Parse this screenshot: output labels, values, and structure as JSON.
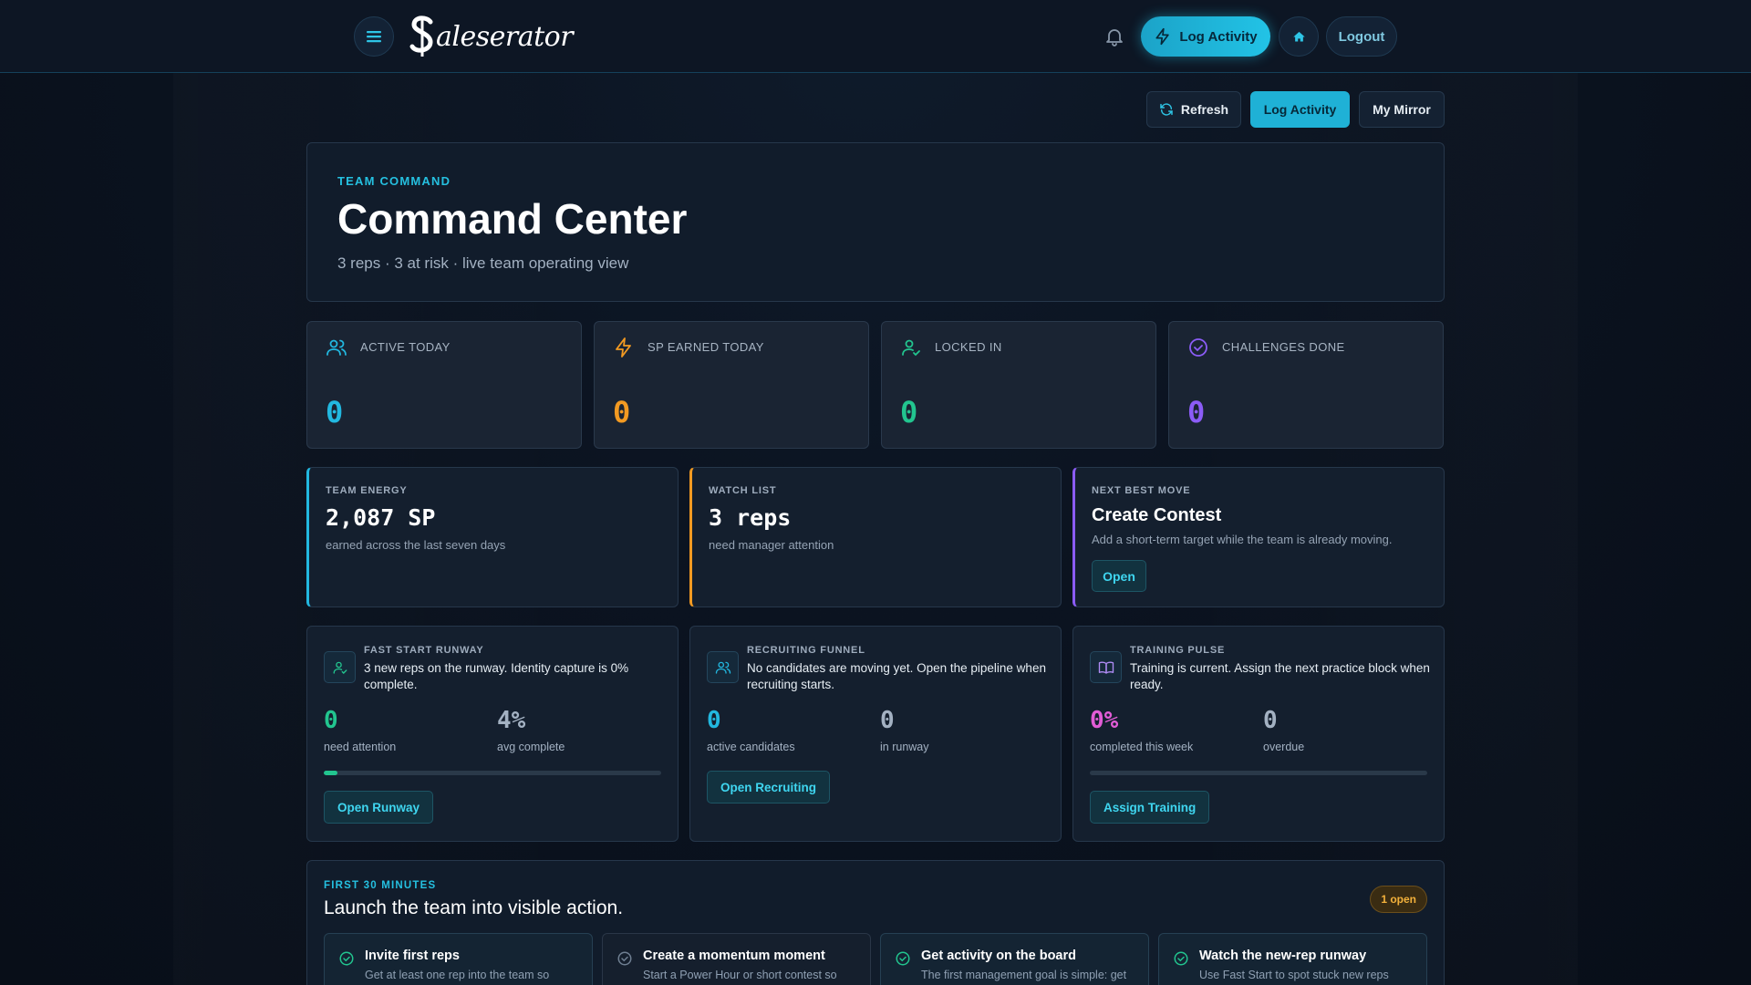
{
  "brand": {
    "logo_text": "Saleserator"
  },
  "nav": {
    "log_activity": "Log Activity",
    "logout": "Logout"
  },
  "actions": {
    "refresh": "Refresh",
    "log_activity": "Log Activity",
    "my_mirror": "My Mirror"
  },
  "hero": {
    "eyebrow": "TEAM COMMAND",
    "title": "Command Center",
    "subtitle": "3 reps · 3 at risk · live team operating view"
  },
  "stats": [
    {
      "label": "ACTIVE TODAY",
      "value": "0",
      "icon": "users-icon",
      "color": "#22b8e0"
    },
    {
      "label": "SP EARNED TODAY",
      "value": "0",
      "icon": "bolt-icon",
      "color": "#f29a22"
    },
    {
      "label": "LOCKED IN",
      "value": "0",
      "icon": "user-check-icon",
      "color": "#22c58f"
    },
    {
      "label": "CHALLENGES DONE",
      "value": "0",
      "icon": "check-circle-icon",
      "color": "#8b5cf6"
    }
  ],
  "summary": {
    "energy": {
      "eyebrow": "TEAM ENERGY",
      "value": "2,087 SP",
      "desc": "earned across the last seven days",
      "accent": "#22b8e0"
    },
    "watch": {
      "eyebrow": "WATCH LIST",
      "value": "3 reps",
      "desc": "need manager attention",
      "accent": "#f29a22"
    },
    "next": {
      "eyebrow": "NEXT BEST MOVE",
      "value": "Create Contest",
      "desc": "Add a short-term target while the team is already moving.",
      "button": "Open",
      "accent": "#8b5cf6"
    }
  },
  "panels": {
    "runway": {
      "eyebrow": "FAST START RUNWAY",
      "text": "3 new reps on the runway. Identity capture is 0% complete.",
      "n1": "0",
      "c1": "need attention",
      "n2": "4%",
      "c2": "avg complete",
      "progress": 0.04,
      "button": "Open Runway"
    },
    "recruiting": {
      "eyebrow": "RECRUITING FUNNEL",
      "text": "No candidates are moving yet. Open the pipeline when recruiting starts.",
      "n1": "0",
      "c1": "active candidates",
      "n2": "0",
      "c2": "in runway",
      "button": "Open Recruiting"
    },
    "training": {
      "eyebrow": "TRAINING PULSE",
      "text": "Training is current. Assign the next practice block when ready.",
      "n1": "0%",
      "c1": "completed this week",
      "n2": "0",
      "c2": "overdue",
      "progress": 0.0,
      "button": "Assign Training"
    }
  },
  "first30": {
    "eyebrow": "FIRST 30 MINUTES",
    "title": "Launch the team into visible action.",
    "badge": "1 open",
    "tasks": [
      {
        "title": "Invite first reps",
        "desc": "Get at least one rep into the team so",
        "done": true
      },
      {
        "title": "Create a momentum moment",
        "desc": "Start a Power Hour or short contest so",
        "done": false
      },
      {
        "title": "Get activity on the board",
        "desc": "The first management goal is simple: get",
        "done": true
      },
      {
        "title": "Watch the new-rep runway",
        "desc": "Use Fast Start to spot stuck new reps",
        "done": true
      }
    ]
  }
}
